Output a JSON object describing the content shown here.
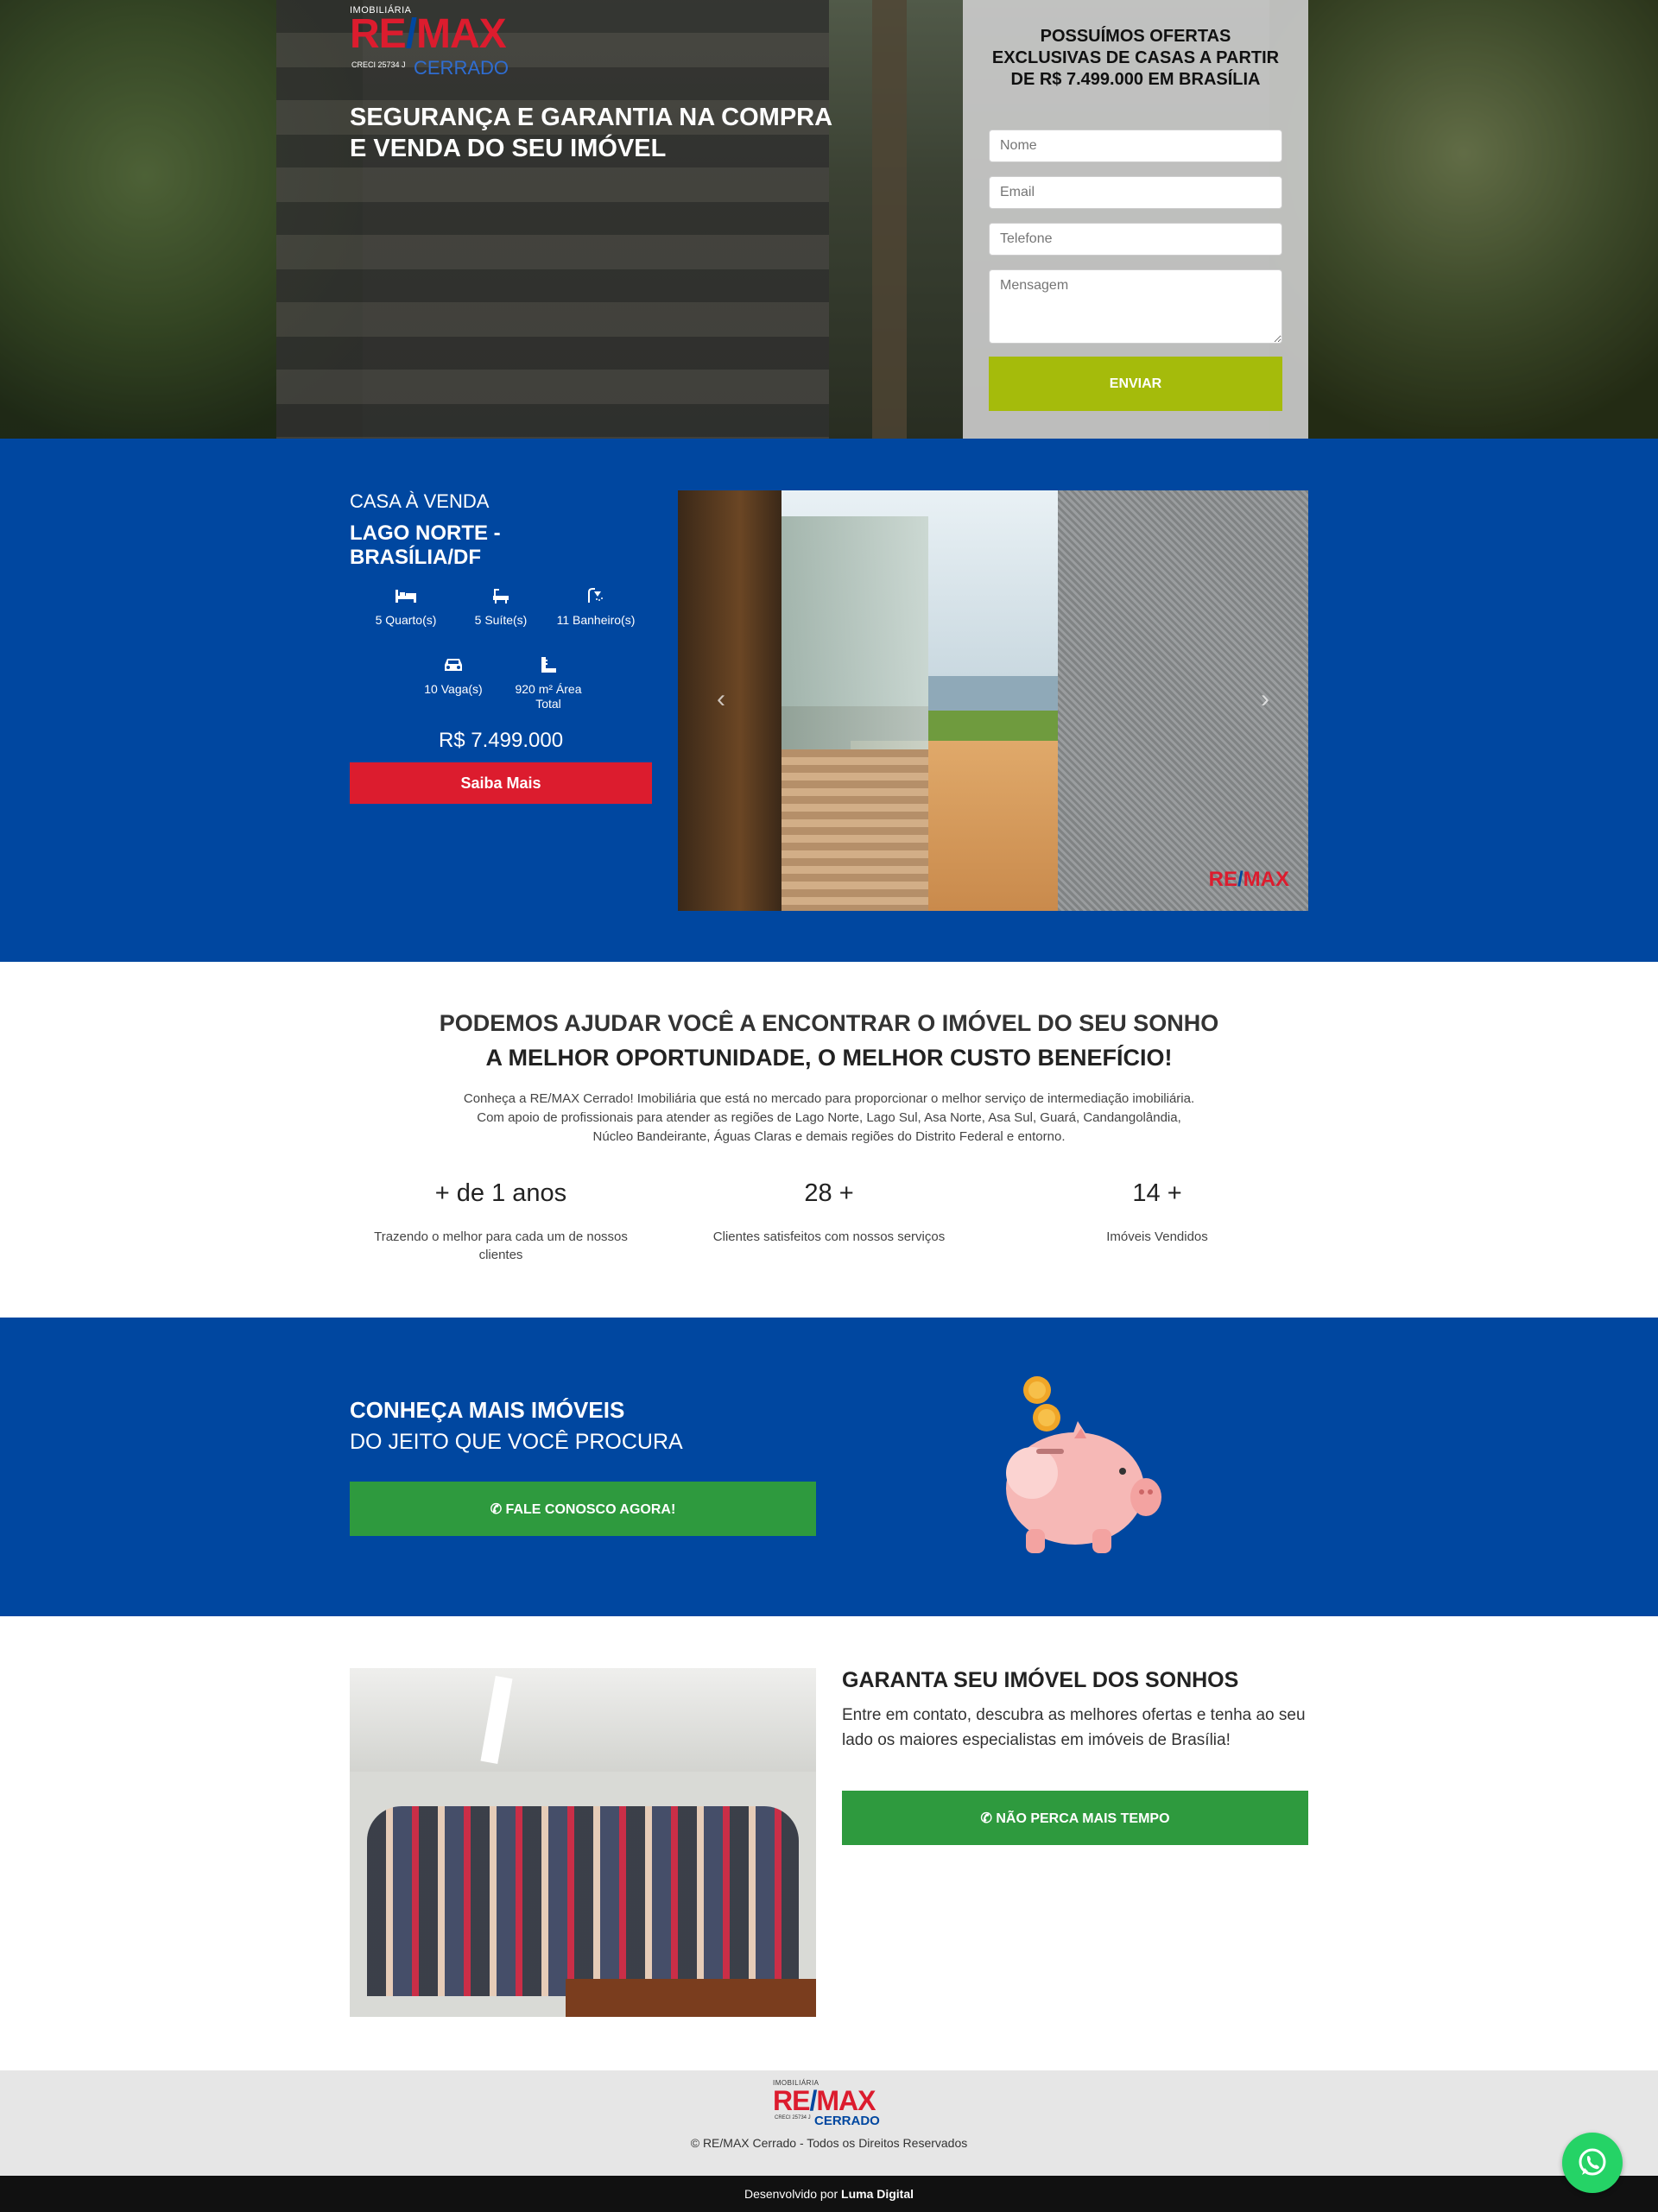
{
  "hero": {
    "logo": {
      "small": "IMOBILIÁRIA",
      "re": "RE",
      "slash": "/",
      "max": "MAX",
      "phone": "CRECI 25734 J",
      "cerrado": "CERRADO"
    },
    "title": "SEGURANÇA E GARANTIA NA COMPRA E VENDA DO SEU IMÓVEL",
    "form": {
      "title": "POSSUÍMOS OFERTAS EXCLUSIVAS DE CASAS A PARTIR DE R$ 7.499.000 EM BRASÍLIA",
      "name_placeholder": "Nome",
      "email_placeholder": "Email",
      "phone_placeholder": "Telefone",
      "message_placeholder": "Mensagem",
      "submit": "ENVIAR"
    }
  },
  "property": {
    "kicker": "CASA À VENDA",
    "location": "LAGO NORTE - BRASÍLIA/DF",
    "features": [
      {
        "icon": "bed-icon",
        "label": "5 Quarto(s)"
      },
      {
        "icon": "bath-icon",
        "label": "5 Suíte(s)"
      },
      {
        "icon": "shower-icon",
        "label": "11 Banheiro(s)"
      },
      {
        "icon": "car-icon",
        "label": "10 Vaga(s)"
      },
      {
        "icon": "ruler-icon",
        "label": "920 m² Área Total"
      }
    ],
    "price": "R$ 7.499.000",
    "button": "Saiba Mais",
    "gallery_watermark_re": "RE",
    "gallery_watermark_slash": "/",
    "gallery_watermark_max": "MAX",
    "prev_arrow": "‹",
    "next_arrow": "›"
  },
  "about": {
    "heading1": "PODEMOS AJUDAR VOCÊ A ENCONTRAR O IMÓVEL DO SEU SONHO",
    "heading2": "A MELHOR OPORTUNIDADE, O MELHOR CUSTO BENEFÍCIO!",
    "paragraph": "Conheça a RE/MAX Cerrado! Imobiliária que está no mercado para proporcionar o melhor serviço de intermediação imobiliária. Com apoio de profissionais para atender as regiões de Lago Norte, Lago Sul, Asa Norte, Asa Sul, Guará, Candangolândia, Núcleo Bandeirante, Águas Claras e demais regiões do Distrito Federal e entorno.",
    "stats": [
      {
        "value": "+ de 1 anos",
        "label": "Trazendo o melhor para cada um de nossos clientes"
      },
      {
        "value": "28 +",
        "label": "Clientes satisfeitos com nossos serviços"
      },
      {
        "value": "14 +",
        "label": "Imóveis Vendidos"
      }
    ]
  },
  "cta": {
    "title": "CONHEÇA MAIS IMÓVEIS",
    "subtitle": "DO JEITO QUE VOCÊ PROCURA",
    "button": "FALE CONOSCO AGORA!"
  },
  "team": {
    "title": "GARANTA SEU IMÓVEL DOS SONHOS",
    "text": "Entre em contato, descubra as melhores ofertas e tenha ao seu lado os maiores especialistas em imóveis de Brasília!",
    "button": "NÃO PERCA MAIS TEMPO"
  },
  "footer": {
    "copyright": "© RE/MAX Cerrado - Todos os Direitos Reservados",
    "credits_prefix": "Desenvolvido por",
    "credits_brand": "Luma Digital"
  },
  "colors": {
    "brand_red": "#dc1c2e",
    "brand_blue": "#0047a0",
    "cta_green": "#2e9a3e",
    "submit_green": "#a5bb0b"
  }
}
